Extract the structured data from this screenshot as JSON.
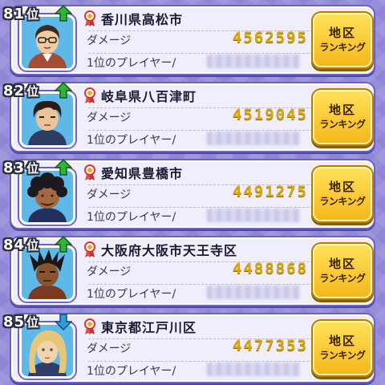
{
  "colors": {
    "background": "#8f87d6",
    "card": "#efeefa",
    "card_border": "#6c62c4",
    "damage_value": "#d6a90c",
    "button_top": "#ffe15a",
    "button_bottom": "#f6b619",
    "trend_up": "#2fb33b",
    "trend_down": "#2f9be0"
  },
  "rows": [
    {
      "rank": "81",
      "rank_suffix": "位",
      "trend": "up",
      "trend_icon": "green-up-arrow-icon",
      "region": "香川県高松市",
      "damage_label": "ダメージ",
      "damage": "4562595",
      "player_label": "1位のプレイヤー/",
      "button_line1": "地区",
      "button_line2": "ランキング"
    },
    {
      "rank": "82",
      "rank_suffix": "位",
      "trend": "up",
      "trend_icon": "green-up-arrow-icon",
      "region": "岐阜県八百津町",
      "damage_label": "ダメージ",
      "damage": "4519045",
      "player_label": "1位のプレイヤー/",
      "button_line1": "地区",
      "button_line2": "ランキング"
    },
    {
      "rank": "83",
      "rank_suffix": "位",
      "trend": "up",
      "trend_icon": "green-up-arrow-icon",
      "region": "愛知県豊橋市",
      "damage_label": "ダメージ",
      "damage": "4491275",
      "player_label": "1位のプレイヤー/",
      "button_line1": "地区",
      "button_line2": "ランキング"
    },
    {
      "rank": "84",
      "rank_suffix": "位",
      "trend": "up",
      "trend_icon": "green-up-arrow-icon",
      "region": "大阪府大阪市天王寺区",
      "damage_label": "ダメージ",
      "damage": "4488868",
      "player_label": "1位のプレイヤー/",
      "button_line1": "地区",
      "button_line2": "ランキング"
    },
    {
      "rank": "85",
      "rank_suffix": "位",
      "trend": "down",
      "trend_icon": "blue-down-arrow-icon",
      "region": "東京都江戸川区",
      "damage_label": "ダメージ",
      "damage": "4477353",
      "player_label": "1位のプレイヤー/",
      "button_line1": "地区",
      "button_line2": "ランキング"
    }
  ]
}
